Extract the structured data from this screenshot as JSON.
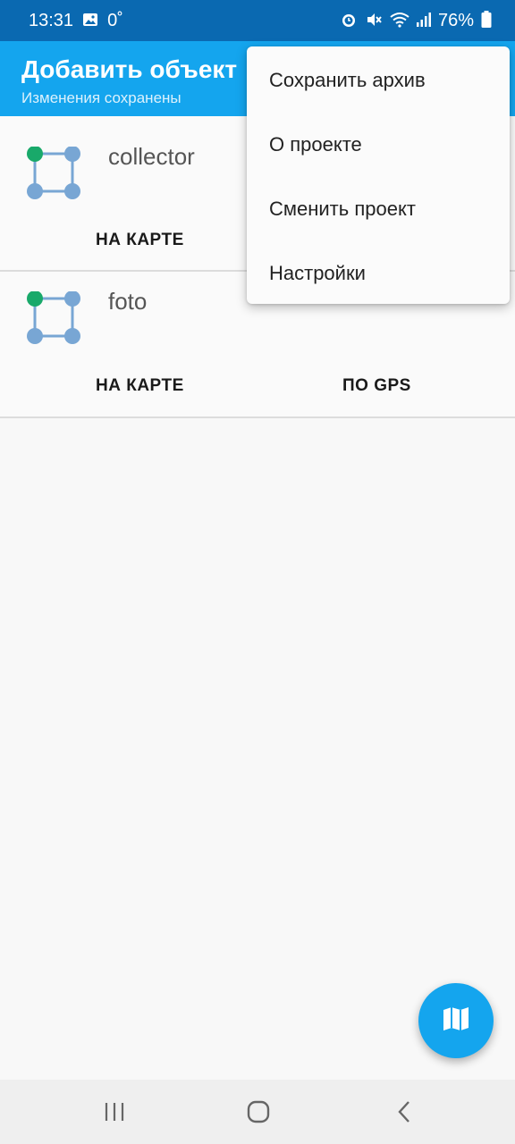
{
  "status_bar": {
    "time": "13:31",
    "temp": "0˚",
    "battery": "76%"
  },
  "app_bar": {
    "title": "Добавить объект",
    "subtitle": "Изменения сохранены"
  },
  "layers": [
    {
      "name": "collector",
      "icon": "polygon-layer-icon",
      "actions": [
        {
          "label": "НА КАРТЕ"
        }
      ]
    },
    {
      "name": "foto",
      "icon": "polygon-layer-icon",
      "actions": [
        {
          "label": "НА КАРТЕ"
        },
        {
          "label": "ПО GPS"
        }
      ]
    }
  ],
  "menu": {
    "items": [
      {
        "label": "Сохранить архив"
      },
      {
        "label": "О проекте"
      },
      {
        "label": "Сменить проект"
      },
      {
        "label": "Настройки"
      }
    ]
  },
  "fab": {
    "icon": "map-icon"
  },
  "colors": {
    "status_bar": "#0a69b1",
    "accent": "#14a5ee",
    "vertex_active": "#19a96a",
    "vertex": "#78a6d4"
  }
}
